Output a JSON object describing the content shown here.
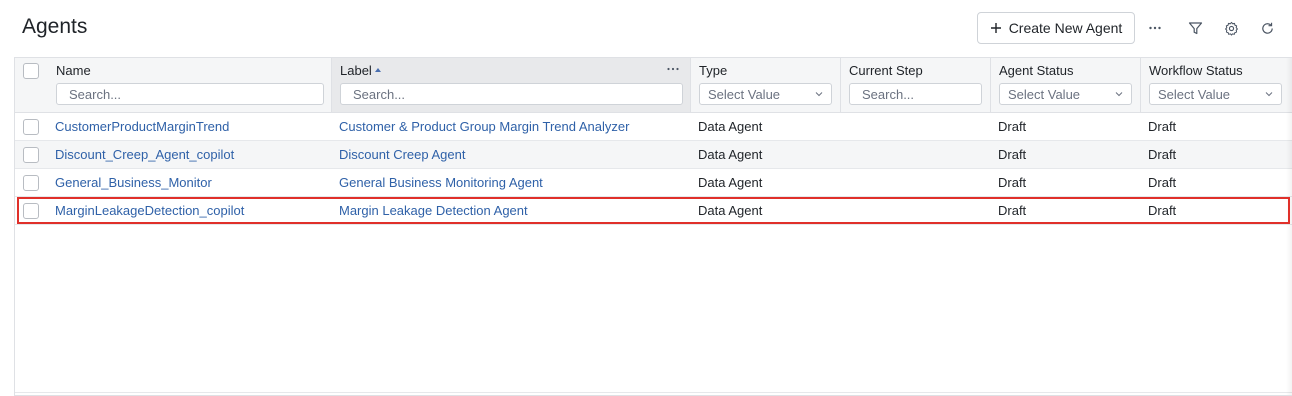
{
  "page": {
    "title": "Agents"
  },
  "toolbar": {
    "create_label": "Create New Agent",
    "icons": [
      "more-icon",
      "filter-icon",
      "settings-icon",
      "refresh-icon"
    ]
  },
  "columns": {
    "name": {
      "label": "Name",
      "filter_placeholder": "Search..."
    },
    "label": {
      "label": "Label",
      "filter_placeholder": "Search...",
      "sort": "ascending"
    },
    "type": {
      "label": "Type",
      "filter_value": "Select Value"
    },
    "current_step": {
      "label": "Current Step",
      "filter_placeholder": "Search..."
    },
    "agent_status": {
      "label": "Agent Status",
      "filter_value": "Select Value"
    },
    "workflow_status": {
      "label": "Workflow Status",
      "filter_value": "Select Value"
    }
  },
  "rows": [
    {
      "name": "CustomerProductMarginTrend",
      "label": "Customer & Product Group Margin Trend Analyzer",
      "type": "Data Agent",
      "current_step": "",
      "agent_status": "Draft",
      "workflow_status": "Draft"
    },
    {
      "name": "Discount_Creep_Agent_copilot",
      "label": "Discount Creep Agent",
      "type": "Data Agent",
      "current_step": "",
      "agent_status": "Draft",
      "workflow_status": "Draft"
    },
    {
      "name": "General_Business_Monitor",
      "label": "General Business Monitoring Agent",
      "type": "Data Agent",
      "current_step": "",
      "agent_status": "Draft",
      "workflow_status": "Draft"
    },
    {
      "name": "MarginLeakageDetection_copilot",
      "label": "Margin Leakage Detection Agent",
      "type": "Data Agent",
      "current_step": "",
      "agent_status": "Draft",
      "workflow_status": "Draft"
    }
  ],
  "highlighted_row": 3,
  "colors": {
    "link": "#2f61a8",
    "highlight": "#e0302a",
    "header_bg": "#f5f6f7",
    "border": "#dfe1e5"
  }
}
